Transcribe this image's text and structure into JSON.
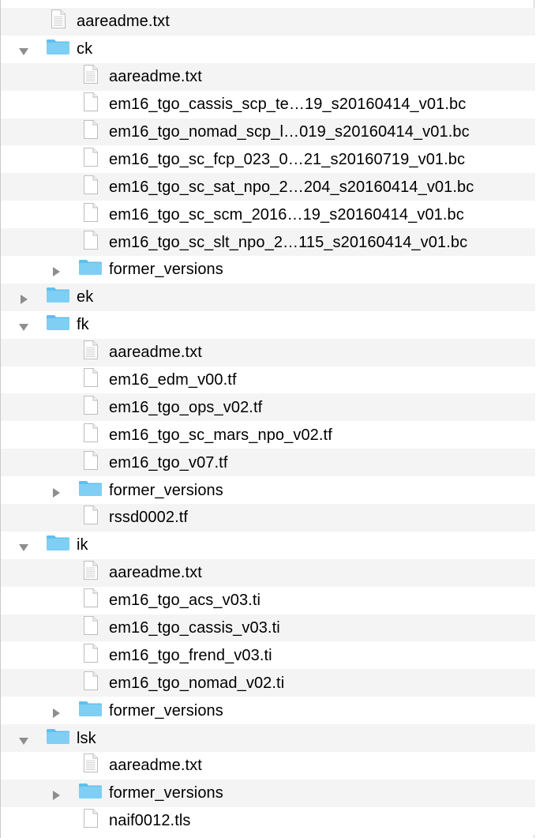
{
  "rows": [
    {
      "depth": 0,
      "type": "file",
      "label": "aareadme.txt",
      "doc": true
    },
    {
      "depth": 0,
      "type": "folder",
      "label": "ck",
      "expanded": true
    },
    {
      "depth": 1,
      "type": "file",
      "label": "aareadme.txt",
      "doc": true
    },
    {
      "depth": 1,
      "type": "file",
      "label": "em16_tgo_cassis_scp_te…19_s20160414_v01.bc"
    },
    {
      "depth": 1,
      "type": "file",
      "label": "em16_tgo_nomad_scp_l…019_s20160414_v01.bc"
    },
    {
      "depth": 1,
      "type": "file",
      "label": "em16_tgo_sc_fcp_023_0…21_s20160719_v01.bc"
    },
    {
      "depth": 1,
      "type": "file",
      "label": "em16_tgo_sc_sat_npo_2…204_s20160414_v01.bc"
    },
    {
      "depth": 1,
      "type": "file",
      "label": "em16_tgo_sc_scm_2016…19_s20160414_v01.bc"
    },
    {
      "depth": 1,
      "type": "file",
      "label": "em16_tgo_sc_slt_npo_2…115_s20160414_v01.bc"
    },
    {
      "depth": 1,
      "type": "folder",
      "label": "former_versions",
      "expanded": false
    },
    {
      "depth": 0,
      "type": "folder",
      "label": "ek",
      "expanded": false
    },
    {
      "depth": 0,
      "type": "folder",
      "label": "fk",
      "expanded": true
    },
    {
      "depth": 1,
      "type": "file",
      "label": "aareadme.txt",
      "doc": true
    },
    {
      "depth": 1,
      "type": "file",
      "label": "em16_edm_v00.tf"
    },
    {
      "depth": 1,
      "type": "file",
      "label": "em16_tgo_ops_v02.tf"
    },
    {
      "depth": 1,
      "type": "file",
      "label": "em16_tgo_sc_mars_npo_v02.tf"
    },
    {
      "depth": 1,
      "type": "file",
      "label": "em16_tgo_v07.tf"
    },
    {
      "depth": 1,
      "type": "folder",
      "label": "former_versions",
      "expanded": false
    },
    {
      "depth": 1,
      "type": "file",
      "label": "rssd0002.tf"
    },
    {
      "depth": 0,
      "type": "folder",
      "label": "ik",
      "expanded": true
    },
    {
      "depth": 1,
      "type": "file",
      "label": "aareadme.txt",
      "doc": true
    },
    {
      "depth": 1,
      "type": "file",
      "label": "em16_tgo_acs_v03.ti"
    },
    {
      "depth": 1,
      "type": "file",
      "label": "em16_tgo_cassis_v03.ti"
    },
    {
      "depth": 1,
      "type": "file",
      "label": "em16_tgo_frend_v03.ti"
    },
    {
      "depth": 1,
      "type": "file",
      "label": "em16_tgo_nomad_v02.ti"
    },
    {
      "depth": 1,
      "type": "folder",
      "label": "former_versions",
      "expanded": false
    },
    {
      "depth": 0,
      "type": "folder",
      "label": "lsk",
      "expanded": true
    },
    {
      "depth": 1,
      "type": "file",
      "label": "aareadme.txt",
      "doc": true
    },
    {
      "depth": 1,
      "type": "folder",
      "label": "former_versions",
      "expanded": false
    },
    {
      "depth": 1,
      "type": "file",
      "label": "naif0012.tls"
    }
  ],
  "colors": {
    "row_alt": "#f4f4f5",
    "folder_fill": "#7fcff4",
    "folder_tab": "#5fc0ee",
    "disclosure": "#8e8e8e",
    "file_outline": "#bdbdbd"
  }
}
